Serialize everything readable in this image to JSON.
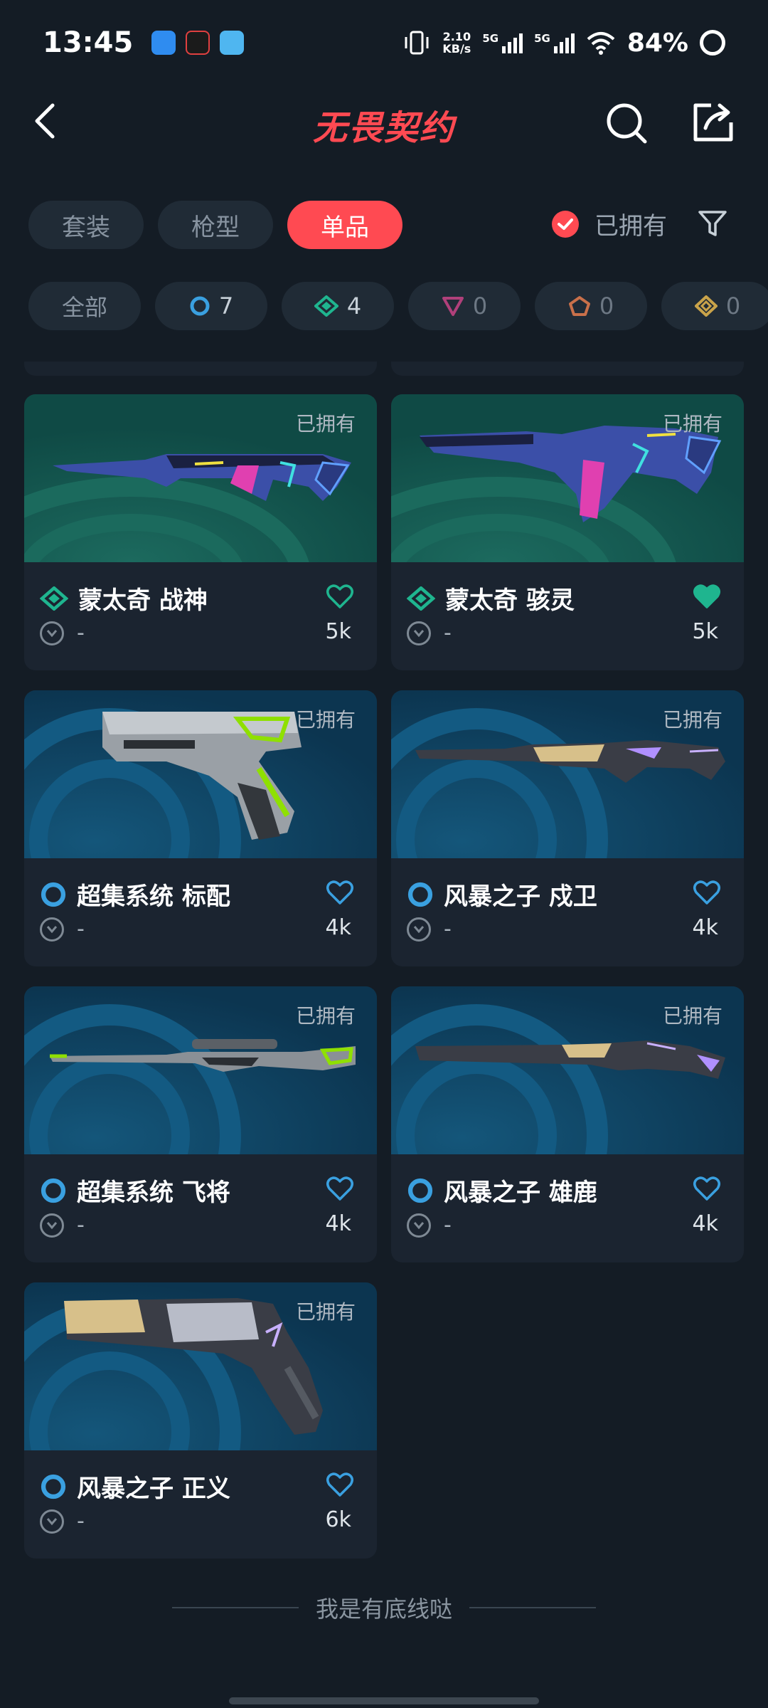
{
  "status_bar": {
    "time": "13:45",
    "net_speed_value": "2.10",
    "net_speed_unit": "KB/s",
    "signal_1": "5G",
    "signal_2": "5G",
    "battery": "84%"
  },
  "header": {
    "brand": "无畏契约",
    "back_icon": "back-arrow-icon",
    "search_icon": "search-icon",
    "share_icon": "share-icon"
  },
  "tabs": [
    {
      "label": "套装",
      "active": false
    },
    {
      "label": "枪型",
      "active": false
    },
    {
      "label": "单品",
      "active": true
    }
  ],
  "owned_filter": {
    "label": "已拥有",
    "checked": true
  },
  "rarity_chips": [
    {
      "label": "全部",
      "icon": "all"
    },
    {
      "count": "7",
      "icon": "select-tier-icon",
      "color": "#3aa0e0"
    },
    {
      "count": "4",
      "icon": "deluxe-tier-icon",
      "color": "#1fb58f"
    },
    {
      "count": "0",
      "icon": "premium-tier-icon",
      "color": "#b0407a"
    },
    {
      "count": "0",
      "icon": "exclusive-tier-icon",
      "color": "#c9704a"
    },
    {
      "count": "0",
      "icon": "ultra-tier-icon",
      "color": "#c9a34a"
    }
  ],
  "items": [
    {
      "name": "蒙太奇 战神",
      "owned_label": "已拥有",
      "sub": "-",
      "likes": "5k",
      "tier": "deluxe",
      "liked": false
    },
    {
      "name": "蒙太奇 骇灵",
      "owned_label": "已拥有",
      "sub": "-",
      "likes": "5k",
      "tier": "deluxe",
      "liked": true
    },
    {
      "name": "超集系统 标配",
      "owned_label": "已拥有",
      "sub": "-",
      "likes": "4k",
      "tier": "select",
      "liked": false
    },
    {
      "name": "风暴之子 戍卫",
      "owned_label": "已拥有",
      "sub": "-",
      "likes": "4k",
      "tier": "select",
      "liked": false
    },
    {
      "name": "超集系统 飞将",
      "owned_label": "已拥有",
      "sub": "-",
      "likes": "4k",
      "tier": "select",
      "liked": false
    },
    {
      "name": "风暴之子 雄鹿",
      "owned_label": "已拥有",
      "sub": "-",
      "likes": "4k",
      "tier": "select",
      "liked": false
    },
    {
      "name": "风暴之子 正义",
      "owned_label": "已拥有",
      "sub": "-",
      "likes": "6k",
      "tier": "select",
      "liked": false
    }
  ],
  "footer": {
    "text": "我是有底线哒"
  },
  "colors": {
    "accent": "#ff4a52",
    "select_tier": "#3aa0e0",
    "deluxe_tier": "#1fb58f",
    "background": "#141c25"
  }
}
